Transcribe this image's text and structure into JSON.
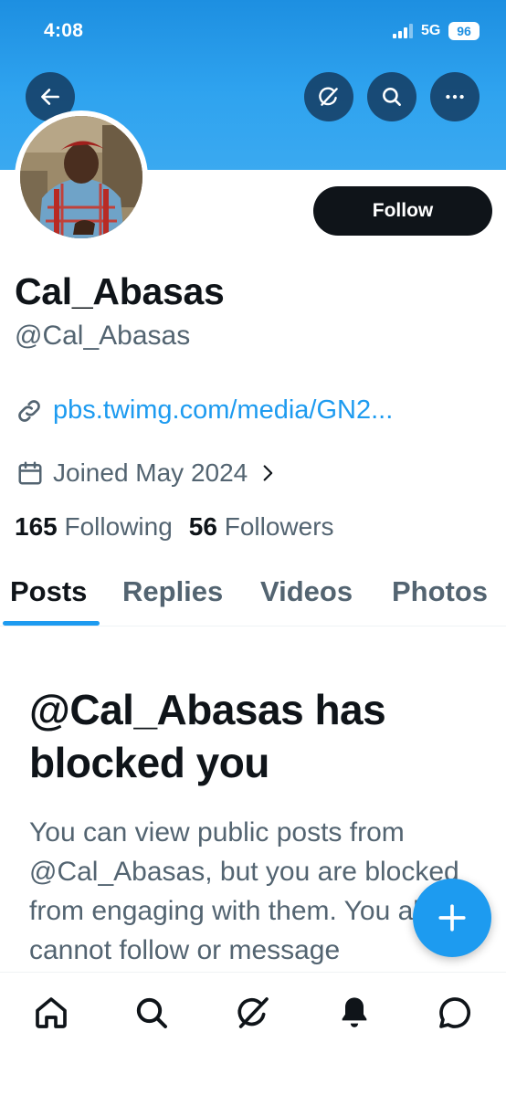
{
  "status_bar": {
    "time": "4:08",
    "network": "5G",
    "battery": "96"
  },
  "header": {
    "back_icon": "arrow-left-icon",
    "grok_icon": "slash-circle-icon",
    "search_icon": "search-icon",
    "more_icon": "more-icon"
  },
  "profile": {
    "display_name": "Cal_Abasas",
    "handle": "@Cal_Abasas",
    "follow_label": "Follow",
    "link": "pbs.twimg.com/media/GN2...",
    "joined": "Joined May 2024",
    "following_count": "165",
    "following_label": "Following",
    "followers_count": "56",
    "followers_label": "Followers"
  },
  "tabs": [
    {
      "label": "Posts",
      "active": true
    },
    {
      "label": "Replies",
      "active": false
    },
    {
      "label": "Videos",
      "active": false
    },
    {
      "label": "Photos",
      "active": false
    }
  ],
  "blocked": {
    "title": "@Cal_Abasas has blocked you",
    "body": "You can view public posts from @Cal_Abasas, but you are blocked from engaging with them. You also cannot follow or message @Cal_Abasas."
  },
  "bottom_nav": [
    "home-icon",
    "search-icon",
    "grok-icon",
    "notifications-bell-icon",
    "messages-icon"
  ],
  "colors": {
    "accent": "#1d9bf0",
    "text": "#0f1419",
    "secondary": "#536471",
    "banner": "#2fa3ef"
  }
}
